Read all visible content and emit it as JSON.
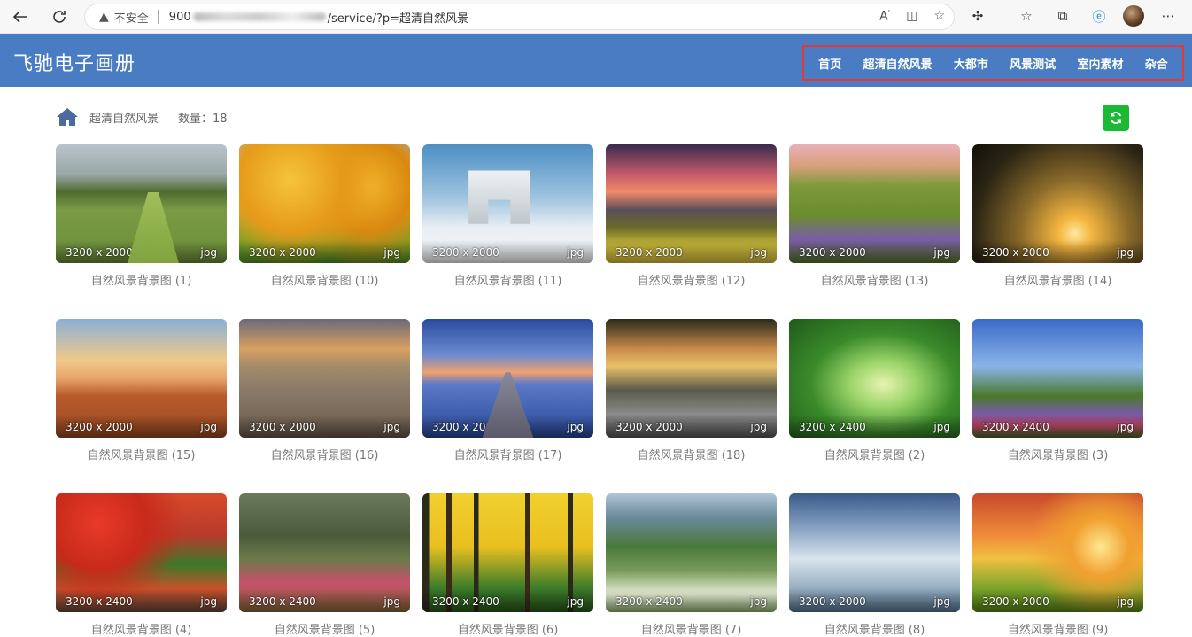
{
  "browser": {
    "security_label": "不安全",
    "url_start": "900",
    "url_end": "/service/?p=超清自然风景"
  },
  "site": {
    "title": "飞驰电子画册",
    "nav": [
      "首页",
      "超清自然风景",
      "大都市",
      "风景测试",
      "室内素材",
      "杂合"
    ]
  },
  "breadcrumb": {
    "category": "超清自然风景",
    "count_label": "数量：18"
  },
  "accent_colors": {
    "header": "#4a7cc3",
    "refresh": "#1bb934",
    "nav_highlight": "#e53935"
  },
  "gallery": [
    {
      "dims": "3200 x 2000",
      "ext": "jpg",
      "caption": "自然风景背景图 (1)"
    },
    {
      "dims": "3200 x 2000",
      "ext": "jpg",
      "caption": "自然风景背景图 (10)"
    },
    {
      "dims": "3200 x 2000",
      "ext": "jpg",
      "caption": "自然风景背景图 (11)"
    },
    {
      "dims": "3200 x 2000",
      "ext": "jpg",
      "caption": "自然风景背景图 (12)"
    },
    {
      "dims": "3200 x 2000",
      "ext": "jpg",
      "caption": "自然风景背景图 (13)"
    },
    {
      "dims": "3200 x 2000",
      "ext": "jpg",
      "caption": "自然风景背景图 (14)"
    },
    {
      "dims": "3200 x 2000",
      "ext": "jpg",
      "caption": "自然风景背景图 (15)"
    },
    {
      "dims": "3200 x 2000",
      "ext": "jpg",
      "caption": "自然风景背景图 (16)"
    },
    {
      "dims": "3200 x 2000",
      "ext": "jpg",
      "caption": "自然风景背景图 (17)"
    },
    {
      "dims": "3200 x 2000",
      "ext": "jpg",
      "caption": "自然风景背景图 (18)"
    },
    {
      "dims": "3200 x 2400",
      "ext": "jpg",
      "caption": "自然风景背景图 (2)"
    },
    {
      "dims": "3200 x 2400",
      "ext": "jpg",
      "caption": "自然风景背景图 (3)"
    },
    {
      "dims": "3200 x 2400",
      "ext": "jpg",
      "caption": "自然风景背景图 (4)"
    },
    {
      "dims": "3200 x 2400",
      "ext": "jpg",
      "caption": "自然风景背景图 (5)"
    },
    {
      "dims": "3200 x 2400",
      "ext": "jpg",
      "caption": "自然风景背景图 (6)"
    },
    {
      "dims": "3200 x 2400",
      "ext": "jpg",
      "caption": "自然风景背景图 (7)"
    },
    {
      "dims": "3200 x 2000",
      "ext": "jpg",
      "caption": "自然风景背景图 (8)"
    },
    {
      "dims": "3200 x 2000",
      "ext": "jpg",
      "caption": "自然风景背景图 (9)"
    }
  ]
}
